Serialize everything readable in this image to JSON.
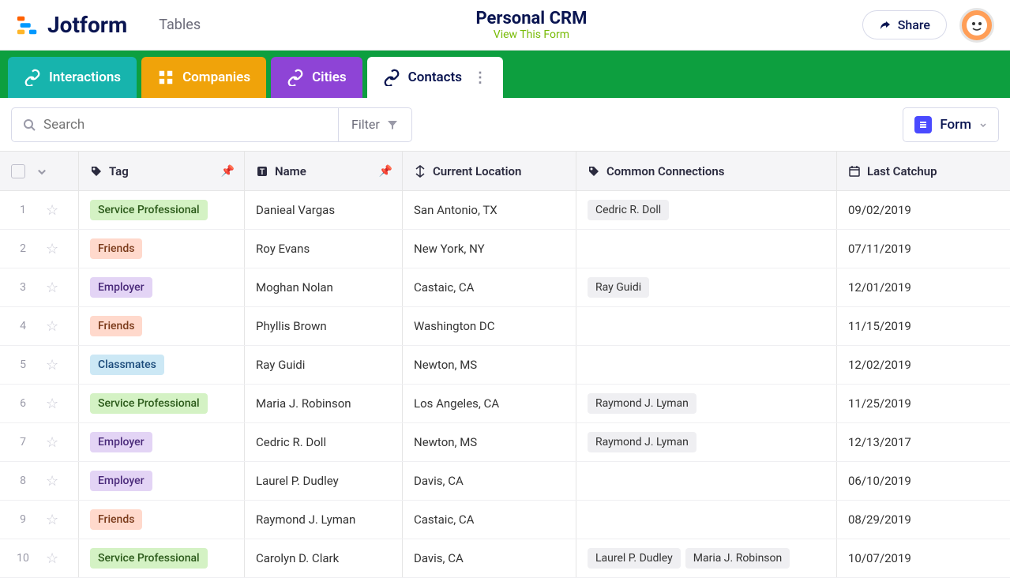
{
  "header": {
    "brand": "Jotform",
    "nav_link": "Tables",
    "title": "Personal CRM",
    "subtitle": "View This Form",
    "share_label": "Share"
  },
  "tabs": [
    {
      "label": "Interactions"
    },
    {
      "label": "Companies"
    },
    {
      "label": "Cities"
    },
    {
      "label": "Contacts"
    }
  ],
  "toolbar": {
    "search_placeholder": "Search",
    "filter_label": "Filter",
    "form_label": "Form"
  },
  "columns": {
    "tag": "Tag",
    "name": "Name",
    "location": "Current Location",
    "connections": "Common Connections",
    "catchup": "Last Catchup"
  },
  "tag_styles": {
    "Service Professional": "tag-service",
    "Friends": "tag-friends",
    "Employer": "tag-employer",
    "Classmates": "tag-classmates"
  },
  "rows": [
    {
      "n": "1",
      "tag": "Service Professional",
      "name": "Danieal Vargas",
      "loc": "San Antonio, TX",
      "conn": [
        "Cedric R. Doll"
      ],
      "date": "09/02/2019"
    },
    {
      "n": "2",
      "tag": "Friends",
      "name": "Roy Evans",
      "loc": "New York, NY",
      "conn": [],
      "date": "07/11/2019"
    },
    {
      "n": "3",
      "tag": "Employer",
      "name": "Moghan Nolan",
      "loc": "Castaic, CA",
      "conn": [
        "Ray Guidi"
      ],
      "date": "12/01/2019"
    },
    {
      "n": "4",
      "tag": "Friends",
      "name": "Phyllis Brown",
      "loc": "Washington DC",
      "conn": [],
      "date": "11/15/2019"
    },
    {
      "n": "5",
      "tag": "Classmates",
      "name": "Ray Guidi",
      "loc": "Newton, MS",
      "conn": [],
      "date": "12/02/2019"
    },
    {
      "n": "6",
      "tag": "Service Professional",
      "name": "Maria J. Robinson",
      "loc": "Los Angeles, CA",
      "conn": [
        "Raymond J. Lyman"
      ],
      "date": "11/25/2019"
    },
    {
      "n": "7",
      "tag": "Employer",
      "name": "Cedric R. Doll",
      "loc": "Newton, MS",
      "conn": [
        "Raymond J. Lyman"
      ],
      "date": "12/13/2017"
    },
    {
      "n": "8",
      "tag": "Employer",
      "name": "Laurel P. Dudley",
      "loc": "Davis, CA",
      "conn": [],
      "date": "06/10/2019"
    },
    {
      "n": "9",
      "tag": "Friends",
      "name": "Raymond J. Lyman",
      "loc": "Castaic, CA",
      "conn": [],
      "date": "08/29/2019"
    },
    {
      "n": "10",
      "tag": "Service Professional",
      "name": "Carolyn D. Clark",
      "loc": "Davis, CA",
      "conn": [
        "Laurel P. Dudley",
        "Maria J. Robinson"
      ],
      "date": "10/07/2019"
    }
  ]
}
